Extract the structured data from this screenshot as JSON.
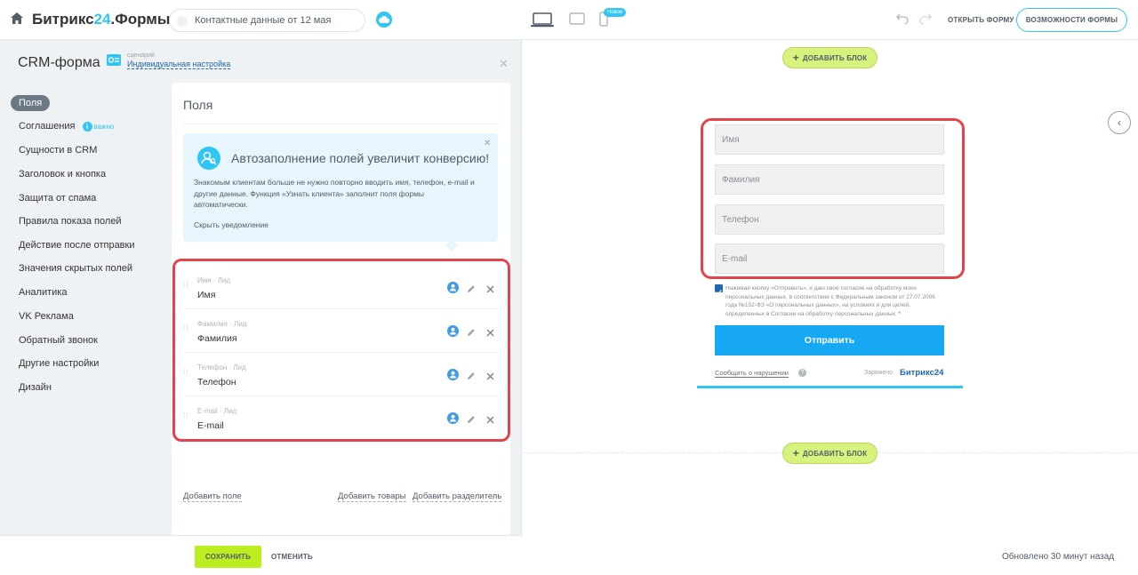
{
  "header": {
    "logo_main": "Битрикс",
    "logo_num": "24",
    "logo_suffix": ".Формы",
    "form_title": "Контактные данные от 12 мая",
    "new_badge": "Новое",
    "open_form": "ОТКРЫТЬ ФОРМУ",
    "features": "ВОЗМОЖНОСТИ ФОРМЫ"
  },
  "panel": {
    "title": "CRM-форма",
    "scenario_label": "сценарий",
    "scenario_value": "Индивидуальная настройка"
  },
  "nav": {
    "items": [
      {
        "label": "Поля"
      },
      {
        "label": "Соглашения"
      },
      {
        "label": "Сущности в CRM"
      },
      {
        "label": "Заголовок и кнопка"
      },
      {
        "label": "Защита от спама"
      },
      {
        "label": "Правила показа полей"
      },
      {
        "label": "Действие после отправки"
      },
      {
        "label": "Значения скрытых полей"
      },
      {
        "label": "Аналитика"
      },
      {
        "label": "VK Реклама"
      },
      {
        "label": "Обратный звонок"
      },
      {
        "label": "Другие настройки"
      },
      {
        "label": "Дизайн"
      }
    ],
    "important": "важно"
  },
  "card": {
    "title": "Поля",
    "promo_title": "Автозаполнение полей увеличит конверсию!",
    "promo_text": "Знакомым клиентам больше не нужно повторно вводить имя, телефон, e-mail и другие данные. Функция «Узнать клиента» заполнит поля формы автоматически.",
    "promo_hide": "Скрыть уведомление",
    "fields": [
      {
        "sub": "Имя · Лид",
        "name": "Имя"
      },
      {
        "sub": "Фамилия · Лид",
        "name": "Фамилия"
      },
      {
        "sub": "Телефон · Лид",
        "name": "Телефон"
      },
      {
        "sub": "E-mail · Лид",
        "name": "E-mail"
      }
    ],
    "add_field": "Добавить поле",
    "add_products": "Добавить товары",
    "add_separator": "Добавить разделитель"
  },
  "footer": {
    "save": "СОХРАНИТЬ",
    "cancel": "ОТМЕНИТЬ"
  },
  "preview": {
    "add_block": "ДОБАВИТЬ БЛОК",
    "placeholders": [
      "Имя",
      "Фамилия",
      "Телефон",
      "E-mail"
    ],
    "consent": "Нажимая кнопку «Отправить», я даю свое согласие на обработку моих персональных данных, в соответствии с Федеральным законом от 27.07.2006 года №152-ФЗ «О персональных данных», на условиях и для целей, определенных в Согласии на обработку персональных данных.",
    "consent_star": "*",
    "submit": "Отправить",
    "report": "Сообщить о нарушении",
    "charged_by": "Заряжено",
    "charged_brand": "Битрикс24",
    "updated": "Обновлено 30 минут назад"
  },
  "colors": {
    "accent": "#2fc6f6",
    "highlight": "#e5434b",
    "save": "#bbed21",
    "submit": "#17a8f3"
  }
}
